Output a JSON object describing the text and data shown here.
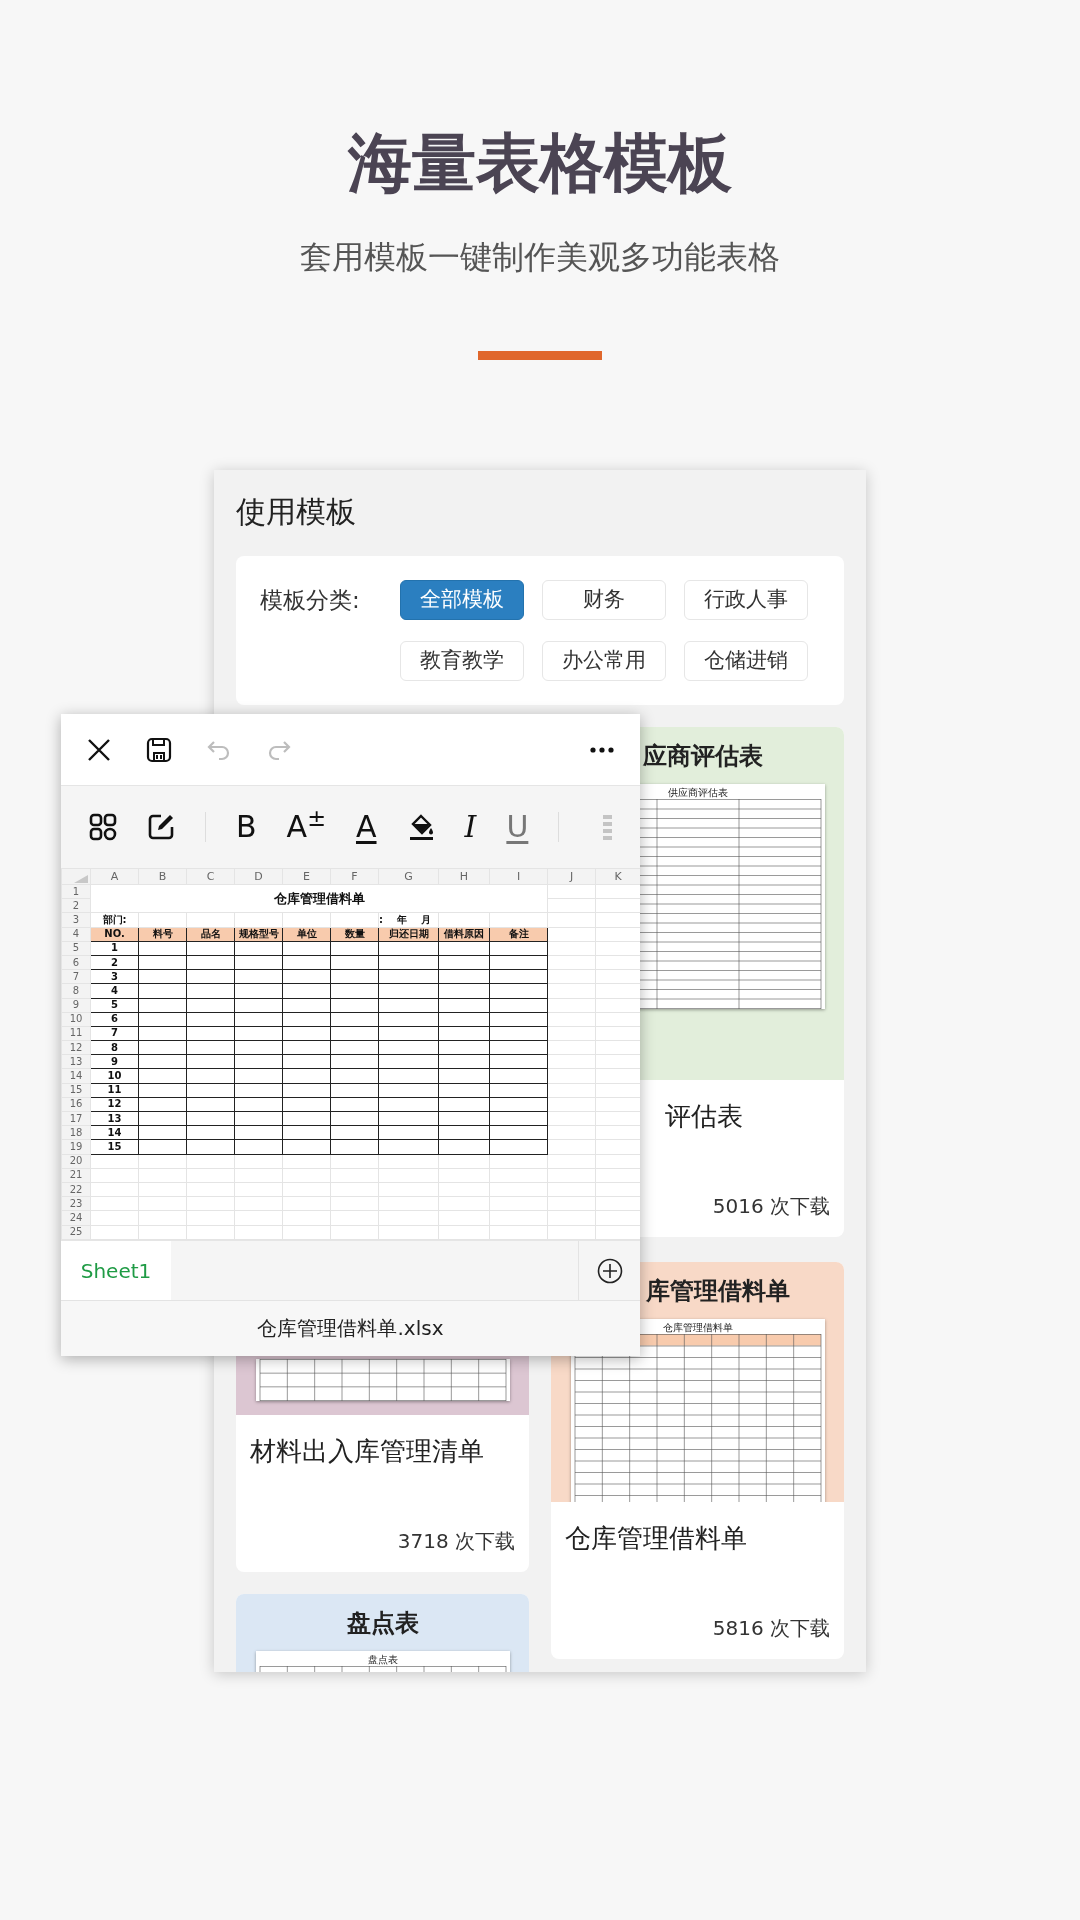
{
  "header": {
    "title": "海量表格模板",
    "subtitle": "套用模板一键制作美观多功能表格"
  },
  "panel": {
    "title": "使用模板",
    "filter_label": "模板分类:",
    "categories": [
      {
        "label": "全部模板",
        "selected": true
      },
      {
        "label": "财务",
        "selected": false
      },
      {
        "label": "行政人事",
        "selected": false
      },
      {
        "label": "教育教学",
        "selected": false
      },
      {
        "label": "办公常用",
        "selected": false
      },
      {
        "label": "仓储进销",
        "selected": false
      }
    ]
  },
  "cards": {
    "left": [
      {
        "title": "材料出入库管理清单",
        "downloads": "3718 次下载",
        "color": "#dcc6d2"
      },
      {
        "header": "盘点表",
        "thumb_title": "盘点表",
        "color": "#dbe7f4"
      }
    ],
    "right": [
      {
        "header": "应商评估表",
        "thumb_title": "供应商评估表",
        "title": "评估表",
        "downloads": "5016 次下载",
        "color": "#e2eedb"
      },
      {
        "header": "库管理借料单",
        "thumb_title": "仓库管理借料单",
        "title": "仓库管理借料单",
        "downloads": "5816 次下载",
        "color": "#f8d9c7"
      }
    ]
  },
  "editor": {
    "top_bar": [
      {
        "kind": "close",
        "disabled": false
      },
      {
        "kind": "save",
        "disabled": false
      },
      {
        "kind": "undo",
        "disabled": true
      },
      {
        "kind": "redo",
        "disabled": true
      },
      {
        "kind": "more",
        "disabled": false
      }
    ],
    "toolbar": [
      {
        "kind": "apps"
      },
      {
        "kind": "edit"
      },
      {
        "kind": "divider"
      },
      {
        "kind": "bold",
        "label": "B"
      },
      {
        "kind": "size",
        "label": "A$^{±}$"
      },
      {
        "kind": "color",
        "label": "A"
      },
      {
        "kind": "fill"
      },
      {
        "kind": "italic",
        "label": "I"
      },
      {
        "kind": "underline",
        "label": "U"
      },
      {
        "kind": "divider"
      },
      {
        "kind": "handle"
      }
    ],
    "sheet": {
      "columns": [
        "A",
        "B",
        "C",
        "D",
        "E",
        "F",
        "G",
        "H",
        "I",
        "J",
        "K"
      ],
      "row_numbers": [
        "1",
        "2",
        "3",
        "4",
        "5",
        "6",
        "7",
        "8",
        "9",
        "10",
        "11",
        "12",
        "13",
        "14",
        "15",
        "16",
        "17",
        "18",
        "19",
        "20",
        "21",
        "22",
        "23",
        "24",
        "25"
      ],
      "title": "仓库管理借料单",
      "dept_label": "部门:",
      "date_labels": [
        ":",
        "年",
        "月"
      ],
      "headers": [
        "NO.",
        "料号",
        "品名",
        "规格型号",
        "单位",
        "数量",
        "归还日期",
        "借料原因",
        "备注"
      ],
      "item_numbers": [
        "1",
        "2",
        "3",
        "4",
        "5",
        "6",
        "7",
        "8",
        "9",
        "10",
        "11",
        "12",
        "13",
        "14",
        "15"
      ]
    },
    "sheet_tabs": [
      {
        "label": "Sheet1",
        "selected": true
      }
    ],
    "filename": "仓库管理借料单.xlsx"
  }
}
